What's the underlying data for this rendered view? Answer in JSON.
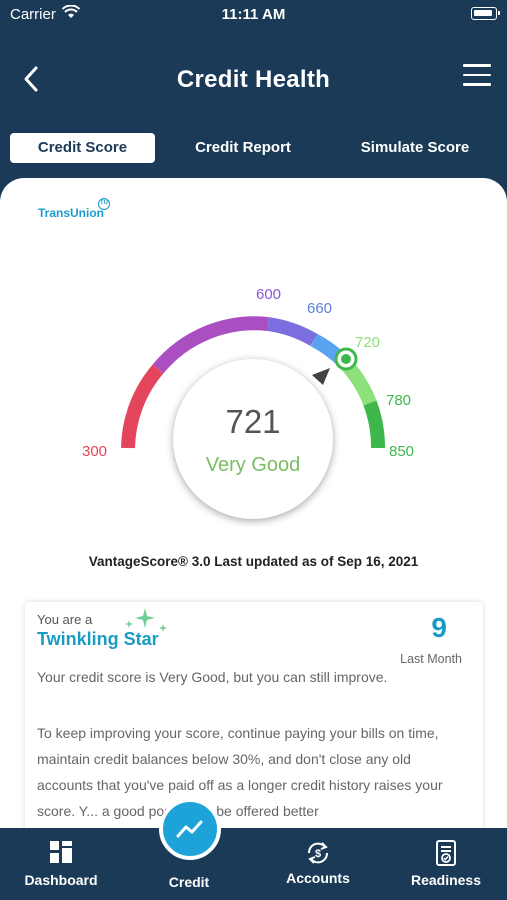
{
  "status_bar": {
    "carrier": "Carrier",
    "time": "11:11 AM"
  },
  "nav": {
    "title": "Credit Health"
  },
  "tabs": [
    {
      "label": "Credit Score",
      "active": true
    },
    {
      "label": "Credit Report",
      "active": false
    },
    {
      "label": "Simulate Score",
      "active": false
    }
  ],
  "brand": {
    "name": "TransUnion",
    "mark": "TU"
  },
  "gauge": {
    "ticks": [
      "300",
      "600",
      "660",
      "720",
      "780",
      "850"
    ],
    "score": "721",
    "rating": "Very Good",
    "colors": {
      "poor": "#e2455c",
      "fair": "#a94fc1",
      "good": "#7b6fe0",
      "very_good": "#5aa3f0",
      "very_good_2": "#8ee07a",
      "excellent": "#3eb84b",
      "rating_text": "#7bbd62"
    }
  },
  "vantage_text": "VantageScore® 3.0 Last updated as of Sep 16, 2021",
  "tier": {
    "you_are": "You are a",
    "name": "Twinkling Star",
    "count": "9",
    "count_label": "Last Month",
    "paragraph_1": "Your credit score is Very Good, but you can still improve.",
    "paragraph_2": "To keep improving your score, continue paying your bills on time, maintain credit balances below 30%, and don't close any old accounts that you've paid off as a longer credit history raises your score. Y... a good position to be offered better"
  },
  "bottom_nav": [
    {
      "label": "Dashboard",
      "icon": "dashboard-icon"
    },
    {
      "label": "Credit",
      "icon": "trend-icon"
    },
    {
      "label": "Accounts",
      "icon": "dollar-cycle-icon"
    },
    {
      "label": "Readiness",
      "icon": "document-check-icon"
    }
  ],
  "colors": {
    "header_bg": "#1b3a57",
    "accent": "#1a9bc4"
  }
}
